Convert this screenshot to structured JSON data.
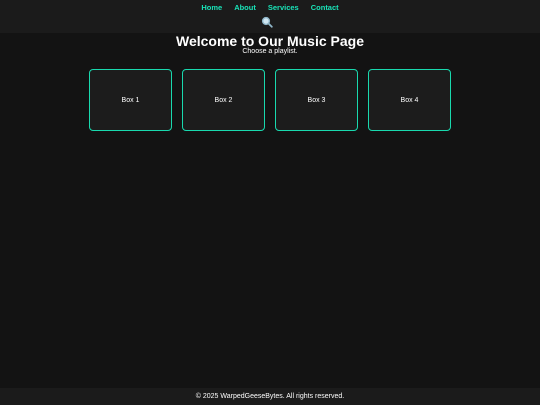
{
  "nav": {
    "items": [
      {
        "label": "Home"
      },
      {
        "label": "About"
      },
      {
        "label": "Services"
      },
      {
        "label": "Contact"
      }
    ],
    "search_icon": "magnifying-glass-icon"
  },
  "main": {
    "title": "Welcome to Our Music Page",
    "subtitle": "Choose a playlist.",
    "boxes": [
      {
        "label": "Box 1"
      },
      {
        "label": "Box 2"
      },
      {
        "label": "Box 3"
      },
      {
        "label": "Box 4"
      }
    ]
  },
  "footer": {
    "text": "© 2025 WarpedGeeseBytes. All rights reserved."
  },
  "colors": {
    "accent": "#19e3b8",
    "background": "#131313",
    "nav_background": "#1b1b1b",
    "box_background": "#1c1c1c"
  }
}
